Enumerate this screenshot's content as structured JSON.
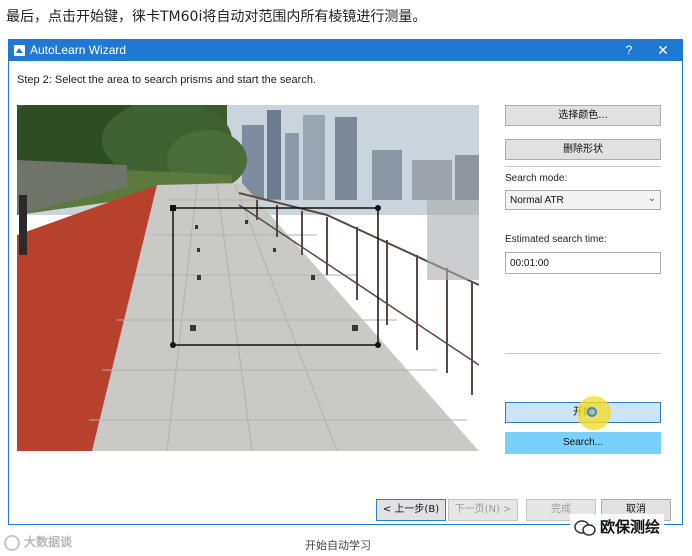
{
  "article": {
    "caption_top": "最后，点击开始键，徕卡TM60i将自动对范围内所有棱镜进行测量。",
    "caption_bottom": "开始自动学习",
    "watermark_left": "大数据谈",
    "watermark_right": "欧保测绘"
  },
  "window": {
    "title": "AutoLearn Wizard",
    "help_label": "?",
    "close_label": "✕"
  },
  "step": {
    "label": "Step 2: Select the area to search prisms and start the search."
  },
  "right_panel": {
    "select_color_label": "选择颜色...",
    "delete_shape_label": "删除形状",
    "search_mode_label": "Search mode:",
    "search_mode_value": "Normal ATR",
    "estimated_time_label": "Estimated search time:",
    "estimated_time_value": "00:01:00",
    "start_label": "开始",
    "search_label": "Search..."
  },
  "footer": {
    "prev_label": "< 上一步(B)",
    "next_label": "下一页(N) >",
    "finish_label": "完成",
    "cancel_label": "取消"
  },
  "colors": {
    "titlebar": "#1f78d1",
    "search_button": "#78d0fb",
    "start_button": "#cce4f7",
    "track_red": "#b8412e"
  }
}
